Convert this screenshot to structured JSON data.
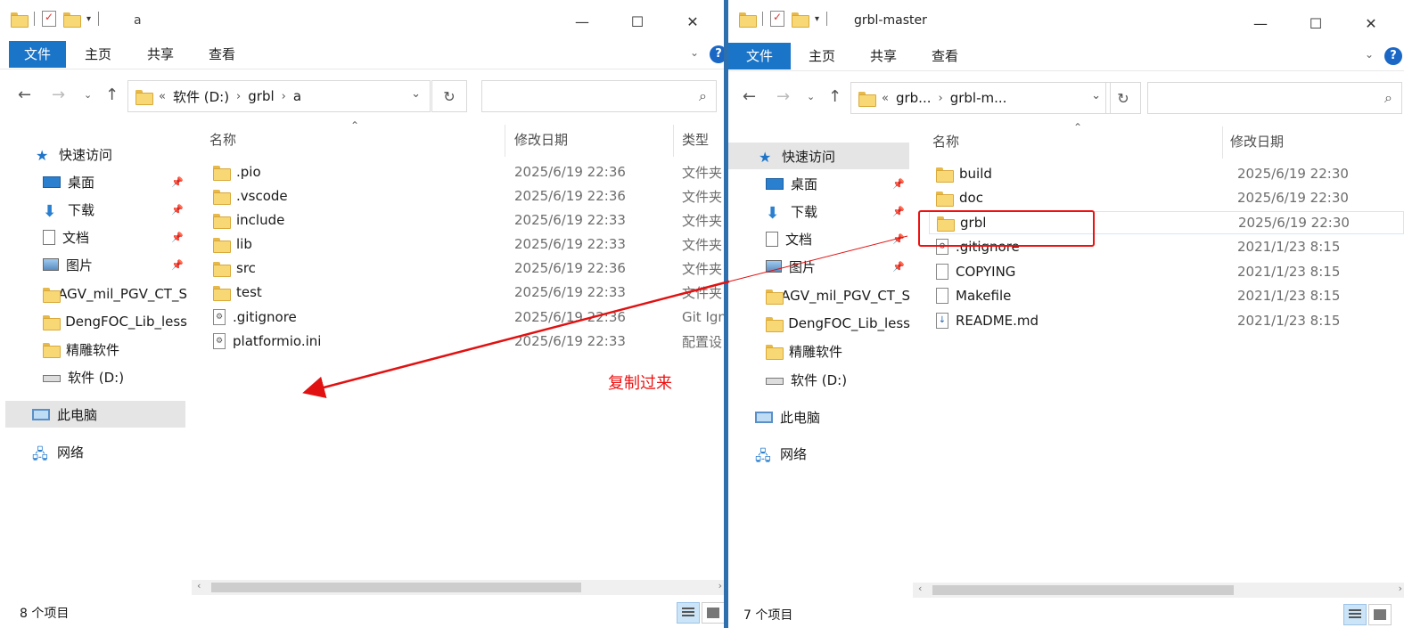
{
  "left_window": {
    "title": "a",
    "ribbon": {
      "file": "文件",
      "home": "主页",
      "share": "共享",
      "view": "查看"
    },
    "address": [
      "«",
      "软件 (D:)",
      "grbl",
      "a"
    ],
    "nav": {
      "quick_access": "快速访问",
      "items": [
        {
          "label": "桌面",
          "icon": "desktop-icon",
          "pinned": true
        },
        {
          "label": "下载",
          "icon": "download-icon",
          "pinned": true
        },
        {
          "label": "文档",
          "icon": "document-icon",
          "pinned": true
        },
        {
          "label": "图片",
          "icon": "pictures-icon",
          "pinned": true
        },
        {
          "label": "AGV_mil_PGV_CT_S",
          "icon": "folder-icon"
        },
        {
          "label": "DengFOC_Lib_less",
          "icon": "folder-icon"
        },
        {
          "label": "精雕软件",
          "icon": "folder-icon"
        },
        {
          "label": "软件 (D:)",
          "icon": "drive-icon"
        }
      ],
      "this_pc": "此电脑",
      "network": "网络"
    },
    "columns": {
      "name": "名称",
      "date": "修改日期",
      "type": "类型"
    },
    "files": [
      {
        "name": ".pio",
        "date": "2025/6/19 22:36",
        "type": "文件夹",
        "icon": "folder-icon"
      },
      {
        "name": ".vscode",
        "date": "2025/6/19 22:36",
        "type": "文件夹",
        "icon": "folder-icon"
      },
      {
        "name": "include",
        "date": "2025/6/19 22:33",
        "type": "文件夹",
        "icon": "folder-icon"
      },
      {
        "name": "lib",
        "date": "2025/6/19 22:33",
        "type": "文件夹",
        "icon": "folder-icon"
      },
      {
        "name": "src",
        "date": "2025/6/19 22:36",
        "type": "文件夹",
        "icon": "folder-icon"
      },
      {
        "name": "test",
        "date": "2025/6/19 22:33",
        "type": "文件夹",
        "icon": "folder-icon"
      },
      {
        "name": ".gitignore",
        "date": "2025/6/19 22:36",
        "type": "Git Ign",
        "icon": "config-file-icon"
      },
      {
        "name": "platformio.ini",
        "date": "2025/6/19 22:33",
        "type": "配置设",
        "icon": "config-file-icon"
      }
    ],
    "status": "8 个项目"
  },
  "right_window": {
    "title": "grbl-master",
    "ribbon": {
      "file": "文件",
      "home": "主页",
      "share": "共享",
      "view": "查看"
    },
    "address": [
      "«",
      "grb...",
      "grbl-m..."
    ],
    "nav": {
      "quick_access": "快速访问",
      "items": [
        {
          "label": "桌面",
          "icon": "desktop-icon",
          "pinned": true
        },
        {
          "label": "下载",
          "icon": "download-icon",
          "pinned": true
        },
        {
          "label": "文档",
          "icon": "document-icon",
          "pinned": true
        },
        {
          "label": "图片",
          "icon": "pictures-icon",
          "pinned": true
        },
        {
          "label": "AGV_mil_PGV_CT_S",
          "icon": "folder-icon"
        },
        {
          "label": "DengFOC_Lib_less",
          "icon": "folder-icon"
        },
        {
          "label": "精雕软件",
          "icon": "folder-icon"
        },
        {
          "label": "软件 (D:)",
          "icon": "drive-icon"
        }
      ],
      "this_pc": "此电脑",
      "network": "网络"
    },
    "columns": {
      "name": "名称",
      "date": "修改日期"
    },
    "files": [
      {
        "name": "build",
        "date": "2025/6/19 22:30",
        "icon": "folder-icon"
      },
      {
        "name": "doc",
        "date": "2025/6/19 22:30",
        "icon": "folder-icon"
      },
      {
        "name": "grbl",
        "date": "2025/6/19 22:30",
        "icon": "folder-icon"
      },
      {
        "name": ".gitignore",
        "date": "2021/1/23 8:15",
        "icon": "config-file-icon"
      },
      {
        "name": "COPYING",
        "date": "2021/1/23 8:15",
        "icon": "file-icon"
      },
      {
        "name": "Makefile",
        "date": "2021/1/23 8:15",
        "icon": "file-icon"
      },
      {
        "name": "README.md",
        "date": "2021/1/23 8:15",
        "icon": "markdown-file-icon"
      }
    ],
    "status": "7 个项目"
  },
  "annotation": {
    "text": "复制过来",
    "color": "#e11111"
  },
  "colors": {
    "accent": "#1a74c8",
    "selection": "#e5e5e5"
  }
}
